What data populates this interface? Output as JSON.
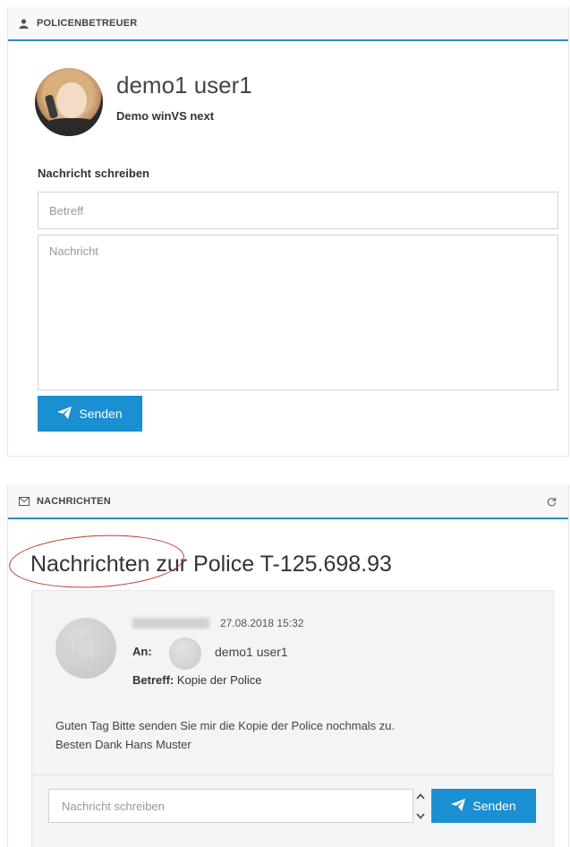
{
  "contact_panel": {
    "header": "POLICENBETREUER",
    "user_name": "demo1 user1",
    "company": "Demo winVS next",
    "write_label": "Nachricht schreiben",
    "subject_placeholder": "Betreff",
    "message_placeholder": "Nachricht",
    "send_label": "Senden"
  },
  "messages_panel": {
    "header": "NACHRICHTEN",
    "title": "Nachrichten zur Police T-125.698.93",
    "message": {
      "date": "27.08.2018 15:32",
      "to_label": "An:",
      "to_name": "demo1 user1",
      "subject_label": "Betreff:",
      "subject": "Kopie der Police",
      "body_line1": "Guten Tag Bitte senden Sie mir die Kopie der Police nochmals zu.",
      "body_line2": "Besten Dank Hans Muster"
    },
    "reply_placeholder": "Nachricht schreiben",
    "send_label": "Senden"
  },
  "colors": {
    "accent": "#1a8fd1",
    "header_border": "#2f8bbf",
    "highlight_circle": "#c0392b"
  }
}
